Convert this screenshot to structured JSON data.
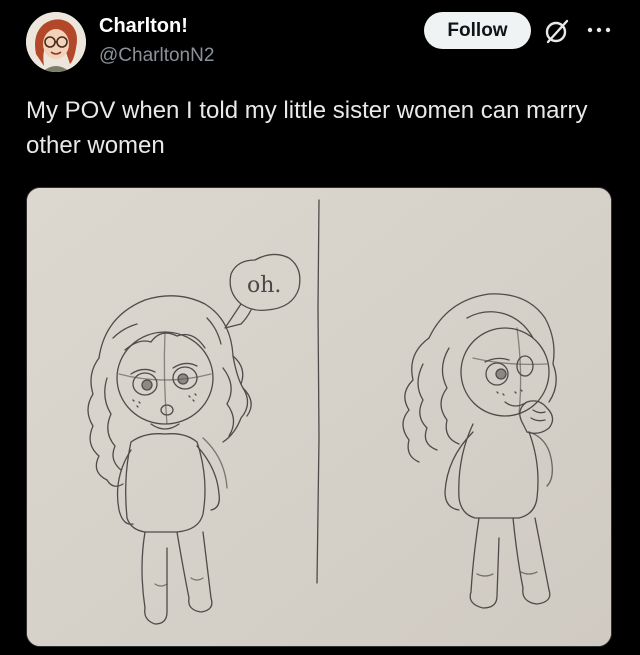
{
  "user": {
    "display_name": "Charlton!",
    "handle": "@CharltonN2"
  },
  "actions": {
    "follow_label": "Follow",
    "grok_icon": "grok-icon",
    "more_icon": "more-options-icon"
  },
  "tweet": {
    "text": "My POV when I told my little sister women can marry other women"
  },
  "media": {
    "speech_bubble_text": "oh."
  },
  "colors": {
    "background": "#000000",
    "text": "#e7e9ea",
    "secondary_text": "#8b9299",
    "follow_button_bg": "#eff3f4",
    "paper": "#d7d3cc"
  }
}
